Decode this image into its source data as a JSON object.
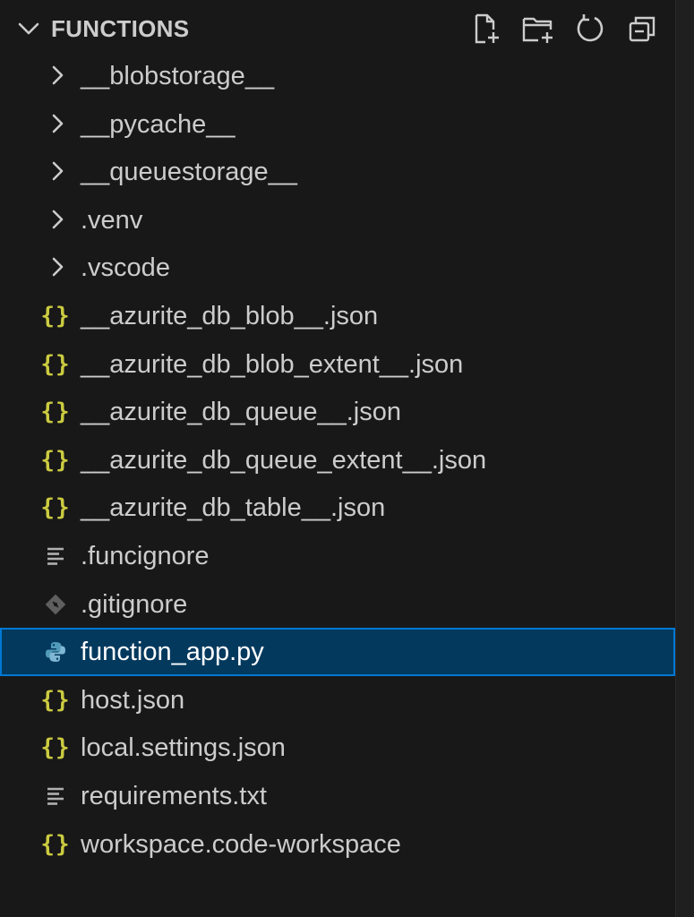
{
  "explorer": {
    "section_title": "FUNCTIONS",
    "actions": [
      {
        "name": "new-file",
        "icon": "new-file-icon"
      },
      {
        "name": "new-folder",
        "icon": "new-folder-icon"
      },
      {
        "name": "refresh",
        "icon": "refresh-icon"
      },
      {
        "name": "collapse-all",
        "icon": "collapse-all-icon"
      }
    ],
    "items": [
      {
        "label": "__blobstorage__",
        "kind": "folder",
        "icon": "chevron-right-icon"
      },
      {
        "label": "__pycache__",
        "kind": "folder",
        "icon": "chevron-right-icon"
      },
      {
        "label": "__queuestorage__",
        "kind": "folder",
        "icon": "chevron-right-icon"
      },
      {
        "label": ".venv",
        "kind": "folder",
        "icon": "chevron-right-icon"
      },
      {
        "label": ".vscode",
        "kind": "folder",
        "icon": "chevron-right-icon"
      },
      {
        "label": "__azurite_db_blob__.json",
        "kind": "json",
        "icon": "json-icon"
      },
      {
        "label": "__azurite_db_blob_extent__.json",
        "kind": "json",
        "icon": "json-icon"
      },
      {
        "label": "__azurite_db_queue__.json",
        "kind": "json",
        "icon": "json-icon"
      },
      {
        "label": "__azurite_db_queue_extent__.json",
        "kind": "json",
        "icon": "json-icon"
      },
      {
        "label": "__azurite_db_table__.json",
        "kind": "json",
        "icon": "json-icon"
      },
      {
        "label": ".funcignore",
        "kind": "text",
        "icon": "text-lines-icon"
      },
      {
        "label": ".gitignore",
        "kind": "git",
        "icon": "git-icon"
      },
      {
        "label": "function_app.py",
        "kind": "python",
        "icon": "python-icon",
        "selected": true
      },
      {
        "label": "host.json",
        "kind": "json",
        "icon": "json-icon"
      },
      {
        "label": "local.settings.json",
        "kind": "json",
        "icon": "json-icon"
      },
      {
        "label": "requirements.txt",
        "kind": "text",
        "icon": "text-lines-icon"
      },
      {
        "label": "workspace.code-workspace",
        "kind": "json",
        "icon": "json-icon"
      }
    ]
  },
  "colors": {
    "background": "#181818",
    "text": "#cccccc",
    "selection_bg": "#04395e",
    "selection_border": "#0078d4",
    "json_icon": "#cbcb41",
    "python_icon": "#519aba",
    "muted_icon": "#8a8a8a"
  }
}
